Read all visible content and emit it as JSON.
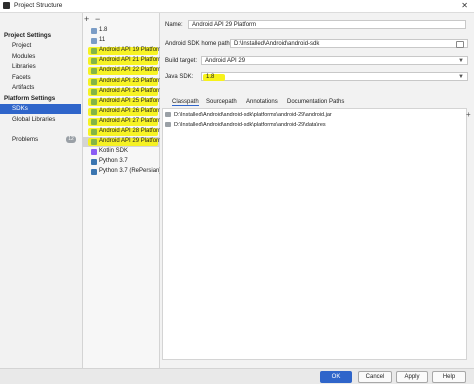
{
  "window": {
    "title": "Project Structure"
  },
  "left_nav": {
    "project_settings_header": "Project Settings",
    "project_settings": [
      "Project",
      "Modules",
      "Libraries",
      "Facets",
      "Artifacts"
    ],
    "platform_settings_header": "Platform Settings",
    "platform_settings": [
      "SDKs",
      "Global Libraries"
    ],
    "problems_label": "Problems",
    "problems_count": "12"
  },
  "sdk_list": {
    "items": [
      {
        "label": "1.8",
        "icon": "folder-icon",
        "highlighted": false
      },
      {
        "label": "11",
        "icon": "folder-icon",
        "highlighted": false
      },
      {
        "label": "Android API 19 Platform",
        "icon": "android-icon",
        "highlighted": true
      },
      {
        "label": "Android API 21 Platform",
        "icon": "android-icon",
        "highlighted": true
      },
      {
        "label": "Android API 22 Platform",
        "icon": "android-icon",
        "highlighted": true
      },
      {
        "label": "Android API 23 Platform",
        "icon": "android-icon",
        "highlighted": true
      },
      {
        "label": "Android API 24 Platform",
        "icon": "android-icon",
        "highlighted": true
      },
      {
        "label": "Android API 25 Platform",
        "icon": "android-icon",
        "highlighted": true
      },
      {
        "label": "Android API 26 Platform",
        "icon": "android-icon",
        "highlighted": true
      },
      {
        "label": "Android API 27 Platform",
        "icon": "android-icon",
        "highlighted": true
      },
      {
        "label": "Android API 28 Platform",
        "icon": "android-icon",
        "highlighted": true
      },
      {
        "label": "Android API 29 Platform",
        "icon": "android-icon",
        "highlighted": true
      },
      {
        "label": "Kotlin SDK",
        "icon": "kotlin-icon",
        "highlighted": false
      },
      {
        "label": "Python 3.7",
        "icon": "python-icon",
        "highlighted": false
      },
      {
        "label": "Python 3.7 (RePersian)",
        "icon": "python-icon",
        "highlighted": false
      }
    ]
  },
  "details": {
    "name_label": "Name:",
    "name_value": "Android API 29 Platform",
    "home_path_label": "Android SDK home path:",
    "home_path_value": "D:\\Installed\\Android\\android-sdk",
    "build_target_label": "Build target:",
    "build_target_value": "Android API 29",
    "java_sdk_label": "Java SDK:",
    "java_sdk_value": "1.8",
    "tabs": [
      "Classpath",
      "Sourcepath",
      "Annotations",
      "Documentation Paths"
    ],
    "classpath_rows": [
      "D:\\Installed\\Android\\android-sdk\\platforms\\android-29\\android.jar",
      "D:\\Installed\\Android\\android-sdk\\platforms\\android-29\\data\\res"
    ]
  },
  "buttons": {
    "ok": "OK",
    "cancel": "Cancel",
    "apply": "Apply",
    "help": "Help"
  },
  "colors": {
    "selection": "#2f65ca",
    "highlight": "#f7f21a"
  }
}
